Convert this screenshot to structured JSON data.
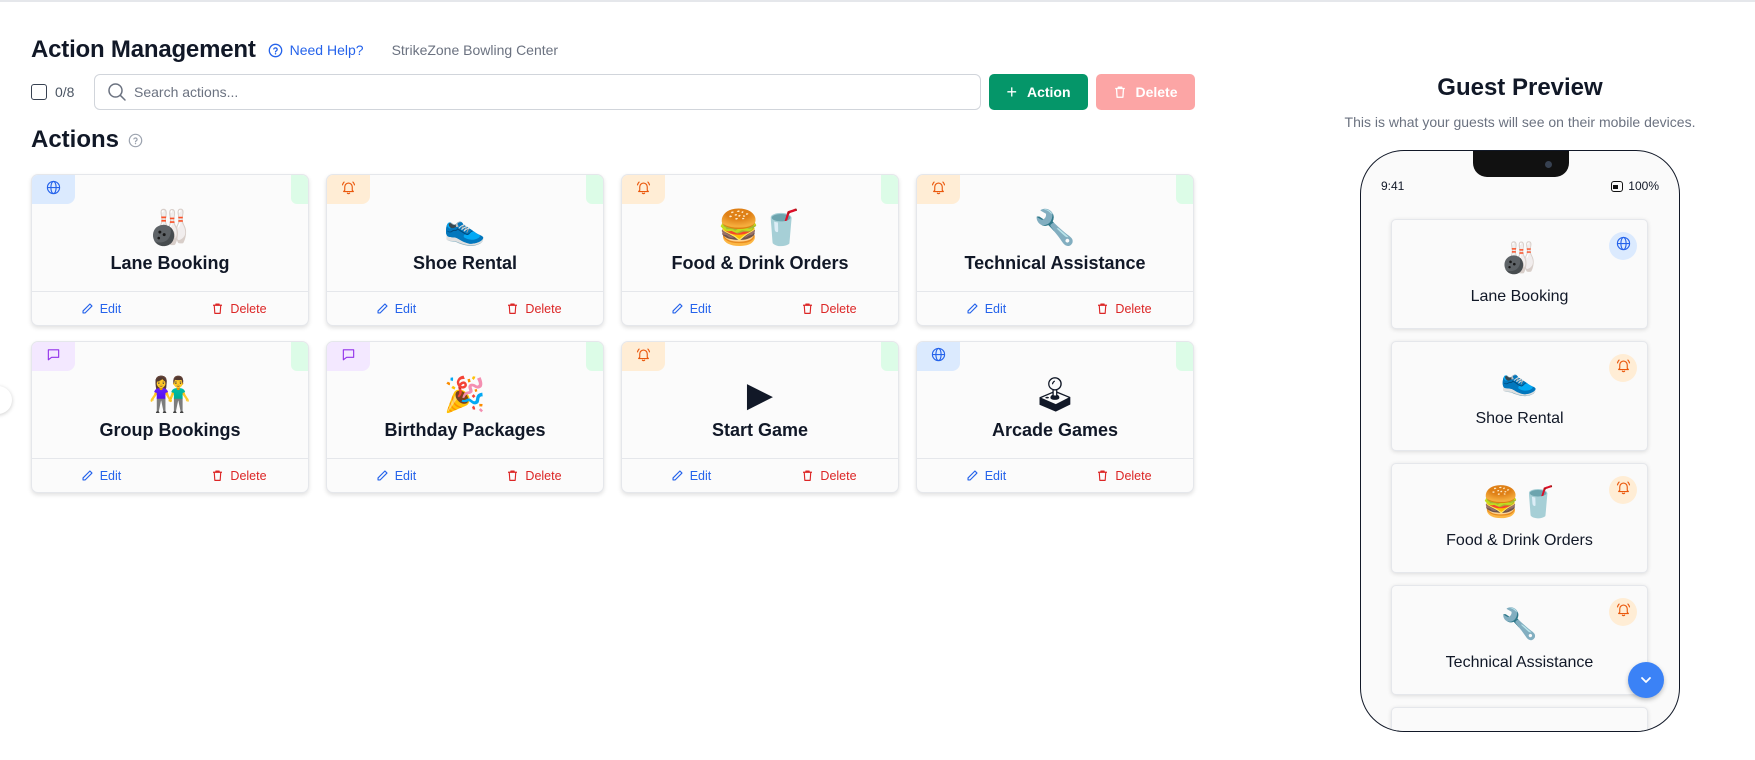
{
  "header": {
    "title": "Action Management",
    "help_label": "Need Help?",
    "venue": "StrikeZone Bowling Center"
  },
  "toolbar": {
    "selection_count": "0/8",
    "search_placeholder": "Search actions...",
    "add_label": "Action",
    "delete_label": "Delete"
  },
  "section": {
    "title": "Actions"
  },
  "colors": {
    "primary_green": "#059669",
    "delete_disabled": "#fca5a5",
    "link_blue": "#2563eb",
    "danger_red": "#dc2626",
    "tag_web": "#dbeafe",
    "tag_notify": "#ffedd5",
    "tag_chat": "#f3e8ff",
    "status_active": "#dcfce7"
  },
  "cards": [
    {
      "name": "Lane Booking",
      "emoji": "🎳",
      "type_icon": "globe-icon",
      "edit": "Edit",
      "delete": "Delete"
    },
    {
      "name": "Shoe Rental",
      "emoji": "👟",
      "type_icon": "bell-icon",
      "edit": "Edit",
      "delete": "Delete"
    },
    {
      "name": "Food & Drink Orders",
      "emoji": "🍔🥤",
      "type_icon": "bell-icon",
      "edit": "Edit",
      "delete": "Delete"
    },
    {
      "name": "Technical Assistance",
      "emoji": "🔧",
      "type_icon": "bell-icon",
      "edit": "Edit",
      "delete": "Delete"
    },
    {
      "name": "Group Bookings",
      "emoji": "👫",
      "type_icon": "chat-icon",
      "edit": "Edit",
      "delete": "Delete"
    },
    {
      "name": "Birthday Packages",
      "emoji": "🎉",
      "type_icon": "chat-icon",
      "edit": "Edit",
      "delete": "Delete"
    },
    {
      "name": "Start Game",
      "emoji": "▶",
      "type_icon": "bell-icon",
      "edit": "Edit",
      "delete": "Delete"
    },
    {
      "name": "Arcade Games",
      "emoji": "🕹",
      "type_icon": "globe-icon",
      "edit": "Edit",
      "delete": "Delete"
    }
  ],
  "preview": {
    "title": "Guest Preview",
    "subtitle": "This is what your guests will see on their mobile devices.",
    "time": "9:41",
    "battery": "100%",
    "items": [
      {
        "name": "Lane Booking",
        "emoji": "🎳",
        "type_icon": "globe-icon"
      },
      {
        "name": "Shoe Rental",
        "emoji": "👟",
        "type_icon": "bell-icon"
      },
      {
        "name": "Food & Drink Orders",
        "emoji": "🍔🥤",
        "type_icon": "bell-icon"
      },
      {
        "name": "Technical Assistance",
        "emoji": "🔧",
        "type_icon": "bell-icon"
      }
    ]
  }
}
